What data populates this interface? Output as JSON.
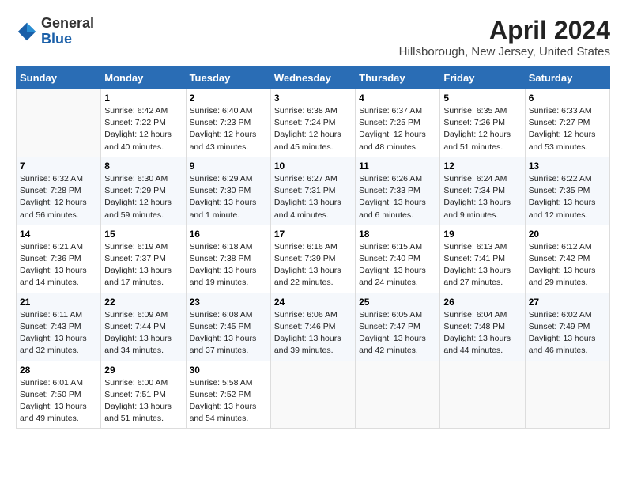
{
  "header": {
    "logo_general": "General",
    "logo_blue": "Blue",
    "month_title": "April 2024",
    "location": "Hillsborough, New Jersey, United States"
  },
  "days_of_week": [
    "Sunday",
    "Monday",
    "Tuesday",
    "Wednesday",
    "Thursday",
    "Friday",
    "Saturday"
  ],
  "weeks": [
    [
      {
        "day": "",
        "info": ""
      },
      {
        "day": "1",
        "info": "Sunrise: 6:42 AM\nSunset: 7:22 PM\nDaylight: 12 hours\nand 40 minutes."
      },
      {
        "day": "2",
        "info": "Sunrise: 6:40 AM\nSunset: 7:23 PM\nDaylight: 12 hours\nand 43 minutes."
      },
      {
        "day": "3",
        "info": "Sunrise: 6:38 AM\nSunset: 7:24 PM\nDaylight: 12 hours\nand 45 minutes."
      },
      {
        "day": "4",
        "info": "Sunrise: 6:37 AM\nSunset: 7:25 PM\nDaylight: 12 hours\nand 48 minutes."
      },
      {
        "day": "5",
        "info": "Sunrise: 6:35 AM\nSunset: 7:26 PM\nDaylight: 12 hours\nand 51 minutes."
      },
      {
        "day": "6",
        "info": "Sunrise: 6:33 AM\nSunset: 7:27 PM\nDaylight: 12 hours\nand 53 minutes."
      }
    ],
    [
      {
        "day": "7",
        "info": "Sunrise: 6:32 AM\nSunset: 7:28 PM\nDaylight: 12 hours\nand 56 minutes."
      },
      {
        "day": "8",
        "info": "Sunrise: 6:30 AM\nSunset: 7:29 PM\nDaylight: 12 hours\nand 59 minutes."
      },
      {
        "day": "9",
        "info": "Sunrise: 6:29 AM\nSunset: 7:30 PM\nDaylight: 13 hours\nand 1 minute."
      },
      {
        "day": "10",
        "info": "Sunrise: 6:27 AM\nSunset: 7:31 PM\nDaylight: 13 hours\nand 4 minutes."
      },
      {
        "day": "11",
        "info": "Sunrise: 6:26 AM\nSunset: 7:33 PM\nDaylight: 13 hours\nand 6 minutes."
      },
      {
        "day": "12",
        "info": "Sunrise: 6:24 AM\nSunset: 7:34 PM\nDaylight: 13 hours\nand 9 minutes."
      },
      {
        "day": "13",
        "info": "Sunrise: 6:22 AM\nSunset: 7:35 PM\nDaylight: 13 hours\nand 12 minutes."
      }
    ],
    [
      {
        "day": "14",
        "info": "Sunrise: 6:21 AM\nSunset: 7:36 PM\nDaylight: 13 hours\nand 14 minutes."
      },
      {
        "day": "15",
        "info": "Sunrise: 6:19 AM\nSunset: 7:37 PM\nDaylight: 13 hours\nand 17 minutes."
      },
      {
        "day": "16",
        "info": "Sunrise: 6:18 AM\nSunset: 7:38 PM\nDaylight: 13 hours\nand 19 minutes."
      },
      {
        "day": "17",
        "info": "Sunrise: 6:16 AM\nSunset: 7:39 PM\nDaylight: 13 hours\nand 22 minutes."
      },
      {
        "day": "18",
        "info": "Sunrise: 6:15 AM\nSunset: 7:40 PM\nDaylight: 13 hours\nand 24 minutes."
      },
      {
        "day": "19",
        "info": "Sunrise: 6:13 AM\nSunset: 7:41 PM\nDaylight: 13 hours\nand 27 minutes."
      },
      {
        "day": "20",
        "info": "Sunrise: 6:12 AM\nSunset: 7:42 PM\nDaylight: 13 hours\nand 29 minutes."
      }
    ],
    [
      {
        "day": "21",
        "info": "Sunrise: 6:11 AM\nSunset: 7:43 PM\nDaylight: 13 hours\nand 32 minutes."
      },
      {
        "day": "22",
        "info": "Sunrise: 6:09 AM\nSunset: 7:44 PM\nDaylight: 13 hours\nand 34 minutes."
      },
      {
        "day": "23",
        "info": "Sunrise: 6:08 AM\nSunset: 7:45 PM\nDaylight: 13 hours\nand 37 minutes."
      },
      {
        "day": "24",
        "info": "Sunrise: 6:06 AM\nSunset: 7:46 PM\nDaylight: 13 hours\nand 39 minutes."
      },
      {
        "day": "25",
        "info": "Sunrise: 6:05 AM\nSunset: 7:47 PM\nDaylight: 13 hours\nand 42 minutes."
      },
      {
        "day": "26",
        "info": "Sunrise: 6:04 AM\nSunset: 7:48 PM\nDaylight: 13 hours\nand 44 minutes."
      },
      {
        "day": "27",
        "info": "Sunrise: 6:02 AM\nSunset: 7:49 PM\nDaylight: 13 hours\nand 46 minutes."
      }
    ],
    [
      {
        "day": "28",
        "info": "Sunrise: 6:01 AM\nSunset: 7:50 PM\nDaylight: 13 hours\nand 49 minutes."
      },
      {
        "day": "29",
        "info": "Sunrise: 6:00 AM\nSunset: 7:51 PM\nDaylight: 13 hours\nand 51 minutes."
      },
      {
        "day": "30",
        "info": "Sunrise: 5:58 AM\nSunset: 7:52 PM\nDaylight: 13 hours\nand 54 minutes."
      },
      {
        "day": "",
        "info": ""
      },
      {
        "day": "",
        "info": ""
      },
      {
        "day": "",
        "info": ""
      },
      {
        "day": "",
        "info": ""
      }
    ]
  ]
}
